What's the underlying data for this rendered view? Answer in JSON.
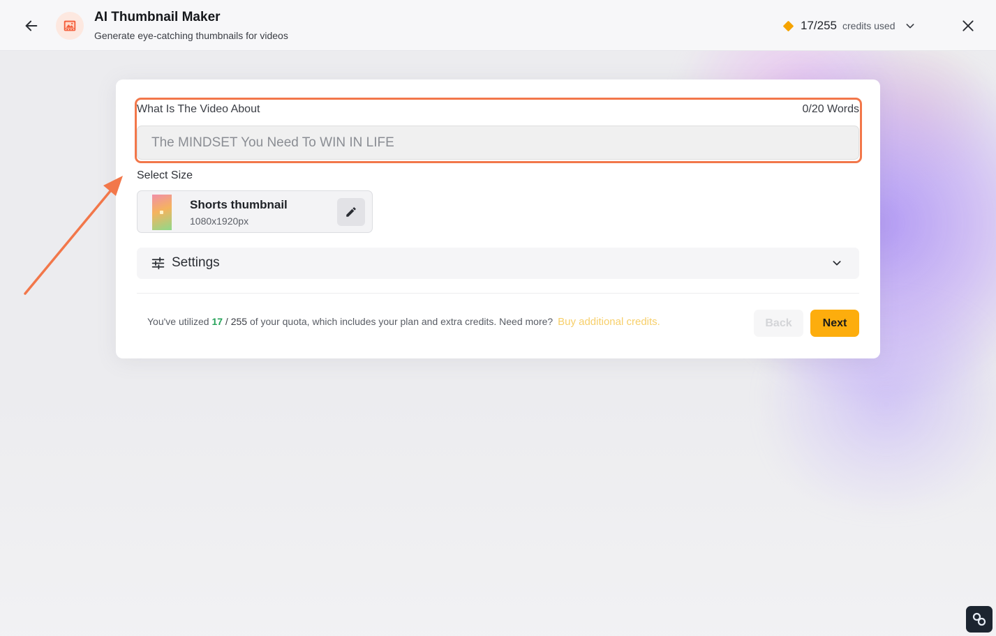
{
  "header": {
    "title": "AI Thumbnail Maker",
    "subtitle": "Generate eye-catching thumbnails for videos",
    "credits_count": "17/255",
    "credits_label": "credits used",
    "back_icon": "arrow-left-icon",
    "app_icon": "image-icon",
    "close_icon": "close-icon"
  },
  "form": {
    "video_label": "What Is The Video About",
    "word_count": "0/20 Words",
    "video_placeholder": "The MINDSET You Need To WIN IN LIFE",
    "video_value": "",
    "size_label": "Select Size",
    "size": {
      "name": "Shorts thumbnail",
      "dimensions": "1080x1920px"
    },
    "settings_label": "Settings"
  },
  "footer": {
    "quota_prefix": "You've utilized",
    "quota_used": "17",
    "quota_sep": "/",
    "quota_total": "255",
    "quota_suffix": "of your quota, which includes your plan and extra credits. Need more?",
    "buy_link": "Buy additional credits.",
    "back_label": "Back",
    "next_label": "Next"
  },
  "colors": {
    "accent": "#fdad0d",
    "highlight": "#f2774a",
    "used": "#27a35a",
    "diamond": "#f5a300"
  }
}
